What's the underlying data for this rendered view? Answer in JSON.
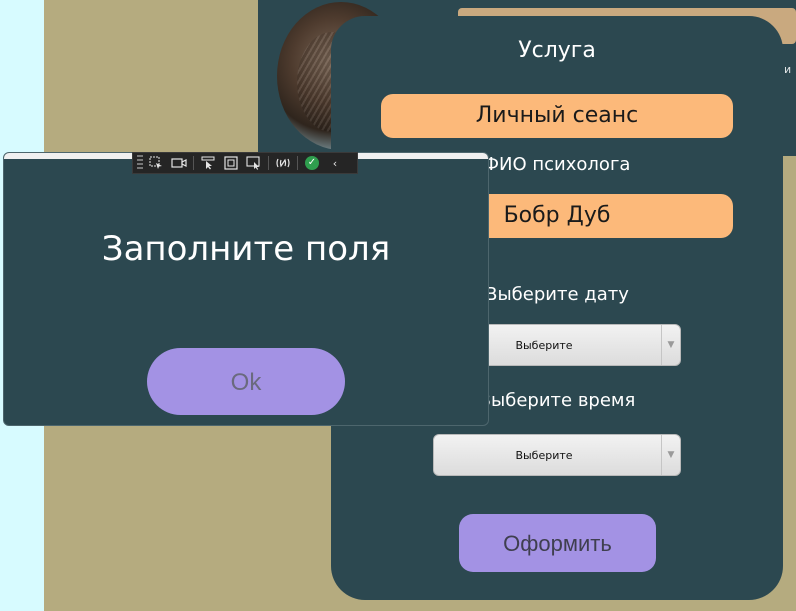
{
  "service_panel": {
    "title": "Услуга",
    "service_value": "Личный сеанс",
    "psychologist_label": "ФИО психолога",
    "psychologist_value": "Бобр Дуб",
    "date_label": "Выберите дату",
    "date_select": "Выберите",
    "time_label": "Выберите время",
    "time_select": "Выберите",
    "submit_label": "Оформить"
  },
  "dialog": {
    "message": "Заполните поля",
    "ok_label": "Ok"
  },
  "background": {
    "text_fragment": "и"
  },
  "debug_toolbar": {
    "icons": [
      "select-element-icon",
      "record-video-icon",
      "pointer-icon",
      "layout-adorner-icon",
      "track-focus-icon",
      "hot-reload-icon",
      "check-icon",
      "collapse-icon"
    ],
    "collapse_glyph": "‹",
    "check_glyph": "✓"
  },
  "colors": {
    "panel_bg": "#2c4850",
    "accent_orange": "#fcb97a",
    "accent_purple": "#a392e4",
    "page_bg": "#b5ab7f"
  }
}
